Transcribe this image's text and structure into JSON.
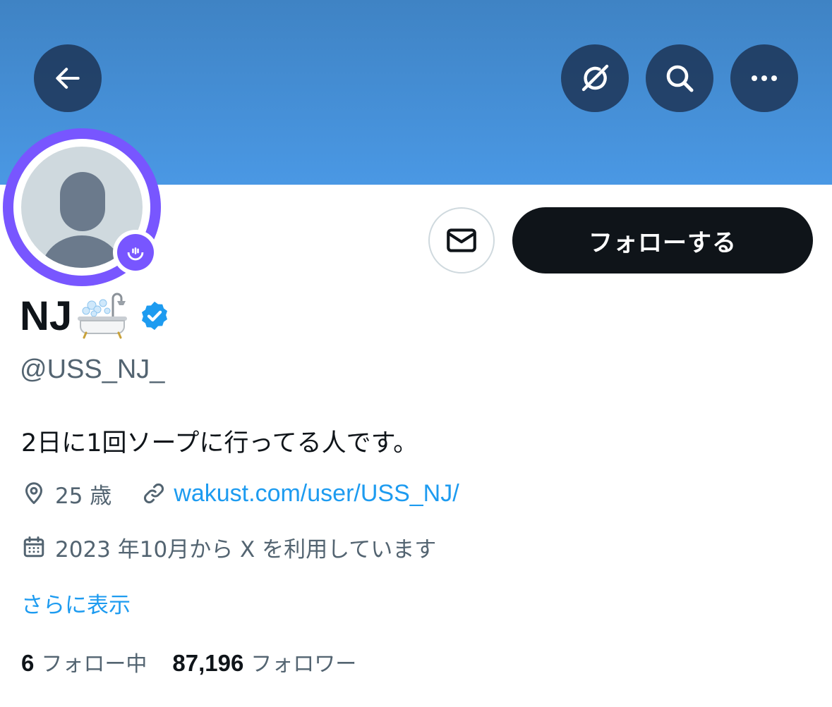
{
  "header": {
    "back_icon": "arrow-left-icon",
    "grok_icon": "grok-icon",
    "search_icon": "search-icon",
    "more_icon": "more-horizontal-icon",
    "banner_color": "#4a98e4"
  },
  "profile": {
    "display_name": "NJ",
    "name_emoji": "bathtub-icon",
    "verified": true,
    "verified_color": "#1d9bf0",
    "handle": "@USS_NJ_",
    "bio": "2日に1回ソープに行ってる人です。",
    "location_icon": "location-pin-icon",
    "location": "25 歳",
    "link_icon": "link-icon",
    "link": "wakust.com/user/USS_NJ/",
    "joined_icon": "calendar-icon",
    "joined": "2023 年10月から X を利用しています",
    "show_more": "さらに表示",
    "avatar_ring_color": "#7856ff"
  },
  "actions": {
    "message_icon": "mail-icon",
    "follow_label": "フォローする"
  },
  "stats": {
    "following_count": "6",
    "following_label": "フォロー中",
    "followers_count": "87,196",
    "followers_label": "フォロワー"
  }
}
